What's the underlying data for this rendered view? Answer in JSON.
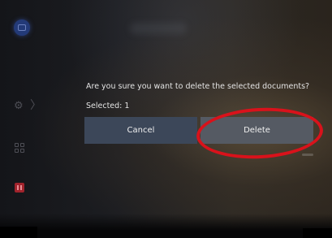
{
  "sidebar": {
    "avatar_icon": "profile-icon",
    "settings_icon": "gear-icon",
    "settings_chevron": "〉",
    "apps_icon": "apps-grid-icon",
    "media_icon": "pause-tile-icon"
  },
  "dialog": {
    "question": "Are you sure you want to delete the selected documents?",
    "selected": "Selected: 1",
    "cancel_label": "Cancel",
    "delete_label": "Delete"
  },
  "colors": {
    "cancel_button": "#3c4759",
    "delete_button": "#555a63",
    "annotation_circle": "#d9121b"
  }
}
